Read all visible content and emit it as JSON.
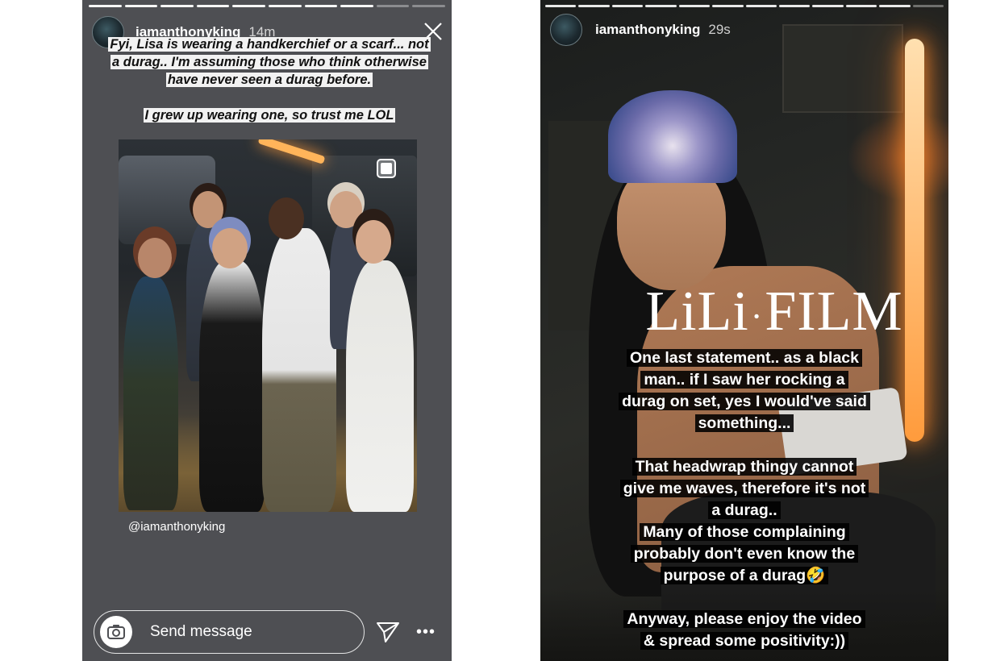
{
  "left_story": {
    "username": "iamanthonyking",
    "time": "14m",
    "caption_lines": [
      "Fyi, Lisa is wearing a handkerchief or a scarf... not",
      "a durag.. I'm assuming those who think otherwise",
      "have never seen a durag before."
    ],
    "caption_footer": "I grew up wearing one, so trust me LOL",
    "photo_mention": "@iamanthonyking",
    "message_placeholder": "Send message"
  },
  "right_story": {
    "username": "iamanthonyking",
    "time": "29s",
    "title_part1": "LiLi",
    "title_dot": "·",
    "title_part2": "FILM",
    "caption_lines": [
      "One last statement.. as a black",
      "man.. if I saw her rocking a",
      "durag on set, yes I would've said",
      "something...",
      "",
      "That headwrap thingy cannot",
      "give me waves, therefore it's not",
      "a durag..",
      "Many of those complaining",
      "probably don't even know the",
      "purpose of a durag🤣",
      "",
      "Anyway, please enjoy the video",
      "& spread some positivity:))"
    ]
  },
  "colors": {
    "left_bg": "#4e4f53",
    "caption_highlight": "#f2f2f2",
    "right_caption_highlight": "#000000"
  },
  "icons": {
    "close": "close-icon",
    "camera": "camera-icon",
    "send": "send-icon",
    "more": "more-icon",
    "copy": "multi-photo-icon"
  }
}
